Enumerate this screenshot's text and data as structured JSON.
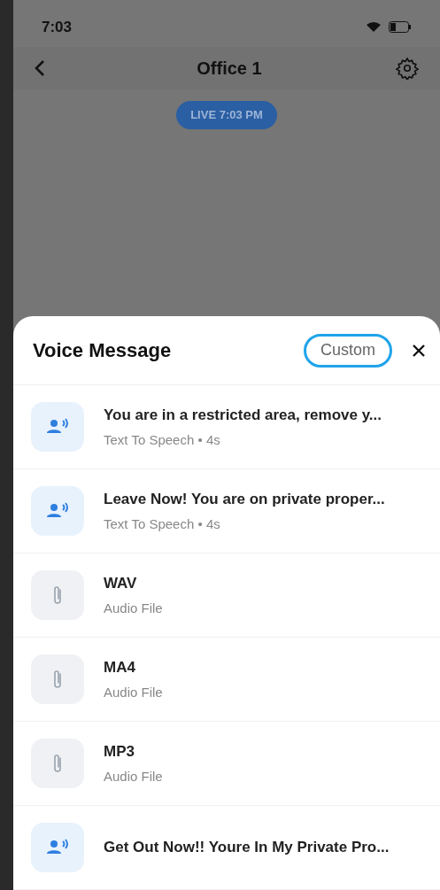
{
  "status_bar": {
    "time": "7:03"
  },
  "nav": {
    "title": "Office 1"
  },
  "live_badge": "LIVE 7:03 PM",
  "sheet": {
    "title": "Voice Message",
    "custom_button": "Custom",
    "items": [
      {
        "kind": "speech",
        "title": "You are in a restricted area, remove y...",
        "subtitle": "Text To Speech • 4s"
      },
      {
        "kind": "speech",
        "title": "Leave Now! You are on private proper...",
        "subtitle": "Text To Speech • 4s"
      },
      {
        "kind": "file",
        "title": "WAV",
        "subtitle": "Audio File"
      },
      {
        "kind": "file",
        "title": "MA4",
        "subtitle": "Audio File"
      },
      {
        "kind": "file",
        "title": "MP3",
        "subtitle": "Audio File"
      },
      {
        "kind": "speech",
        "title": "Get Out Now!! Youre In My Private Pro..."
      }
    ]
  }
}
